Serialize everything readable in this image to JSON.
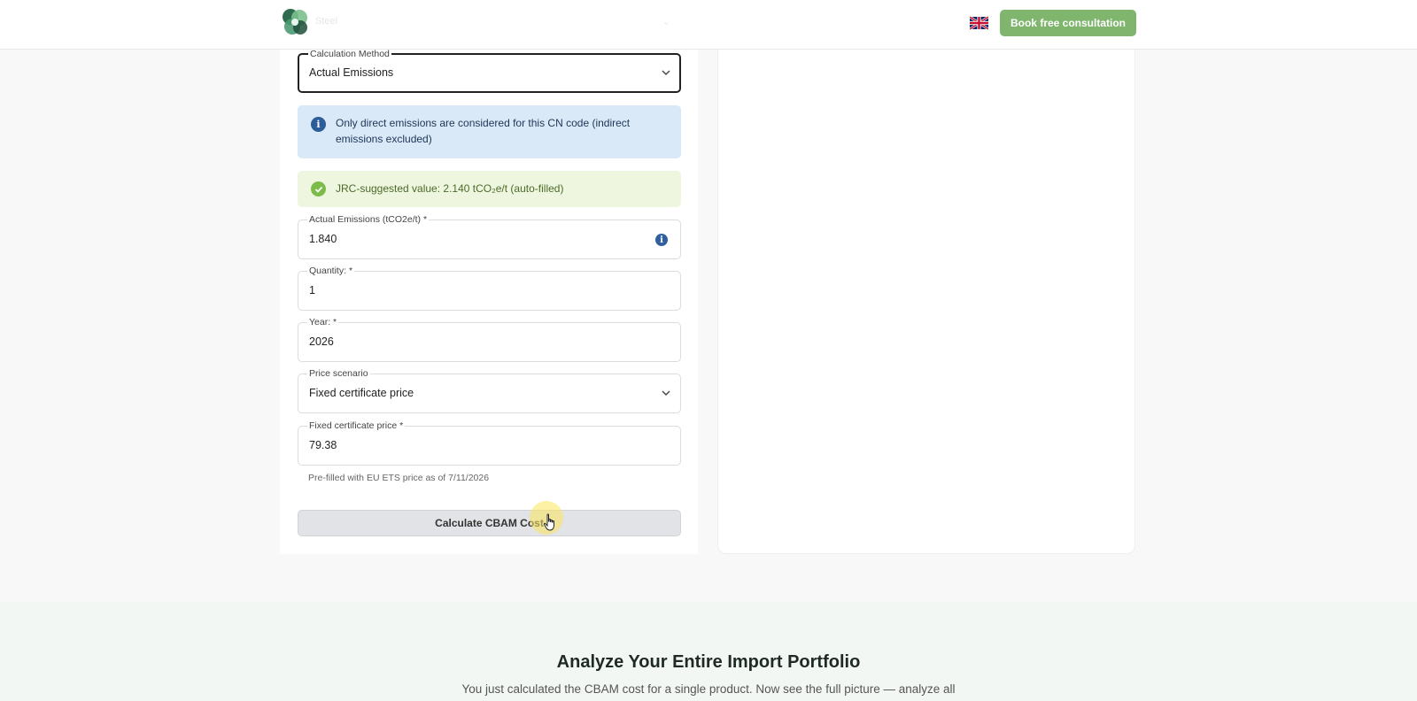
{
  "header": {
    "behind_label": "Steel",
    "book_button": "Book free consultation",
    "language_flag": "uk-flag-icon"
  },
  "form": {
    "calculation_method": {
      "label": "Calculation Method",
      "value": "Actual Emissions"
    },
    "info_alert": "Only direct emissions are considered for this CN code (indirect emissions excluded)",
    "success_alert": "JRC-suggested value: 2.140 tCO₂e/t (auto-filled)",
    "actual_emissions": {
      "label": "Actual Emissions (tCO2e/t) *",
      "value": "1.840"
    },
    "quantity": {
      "label": "Quantity: *",
      "value": "1"
    },
    "year": {
      "label": "Year: *",
      "value": "2026"
    },
    "price_scenario": {
      "label": "Price scenario",
      "value": "Fixed certificate price"
    },
    "fixed_price": {
      "label": "Fixed certificate price *",
      "value": "79.38"
    },
    "helper_text": "Pre-filled with EU ETS price as of 7/11/2026",
    "calculate_button": "Calculate CBAM Cost"
  },
  "portfolio": {
    "title": "Analyze Your Entire Import Portfolio",
    "subtitle": "You just calculated the CBAM cost for a single product. Now see the full picture — analyze all"
  },
  "colors": {
    "accent_green": "#7fb56d",
    "info_blue": "#2c5d98",
    "success_green": "#7dbb48"
  }
}
